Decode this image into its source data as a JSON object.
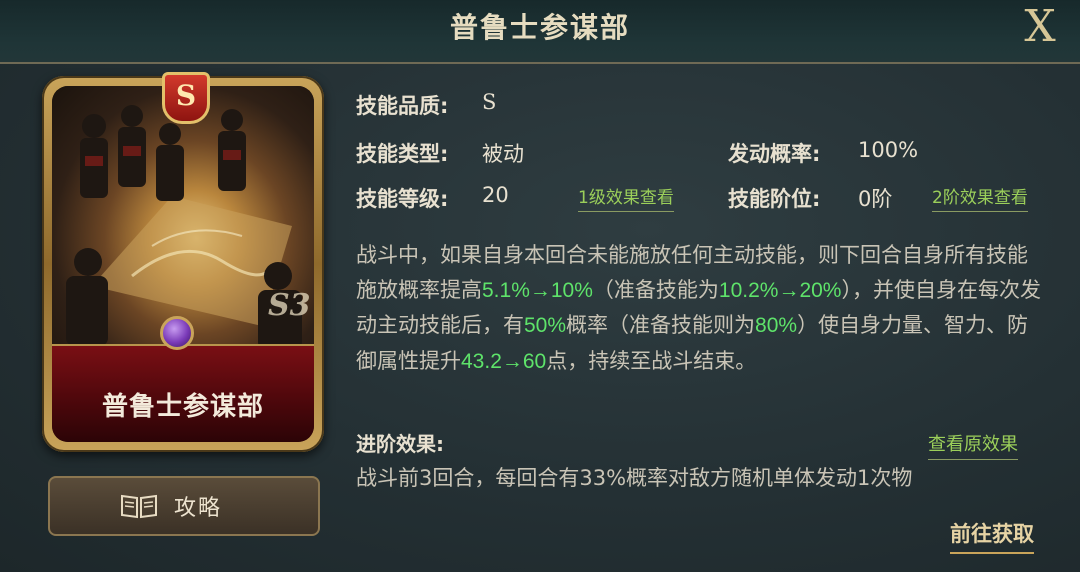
{
  "header": {
    "title": "普鲁士参谋部",
    "close_label": "X"
  },
  "card": {
    "name": "普鲁士参谋部",
    "grade": "S",
    "season_mark": "S3"
  },
  "guide_button": {
    "label": "攻略",
    "icon": "book-icon"
  },
  "info": {
    "quality_label": "技能品质:",
    "quality_value": "S",
    "type_label": "技能类型:",
    "type_value": "被动",
    "rate_label": "发动概率:",
    "rate_value": "100%",
    "level_label": "技能等级:",
    "level_value": "20",
    "level_link": "1级效果查看",
    "rank_label": "技能阶位:",
    "rank_value": "0阶",
    "rank_link": "2阶效果查看"
  },
  "description": {
    "t1": "战斗中，如果自身本回合未能施放任何主动技能，则下回合自身所有技能施放概率提高",
    "h1": "5.1%→10%",
    "t2": "（准备技能为",
    "h2": "10.2%→20%",
    "t3": "），并使自身在每次发动主动技能后，有",
    "h3": "50%",
    "t4": "概率（准备技能则为",
    "h4": "80%",
    "t5": "）使自身力量、智力、防御属性提升",
    "h5": "43.2→60",
    "t6": "点，持续至战斗结束。"
  },
  "advanced": {
    "label": "进阶效果:",
    "link": "查看原效果",
    "text": "战斗前3回合，每回合有33%概率对敌方随机单体发动1次物"
  },
  "goto_label": "前往获取",
  "colors": {
    "highlight": "#5ee36a",
    "link": "#9bcf5a",
    "gold": "#c9a45a",
    "background": "#2a3639"
  }
}
